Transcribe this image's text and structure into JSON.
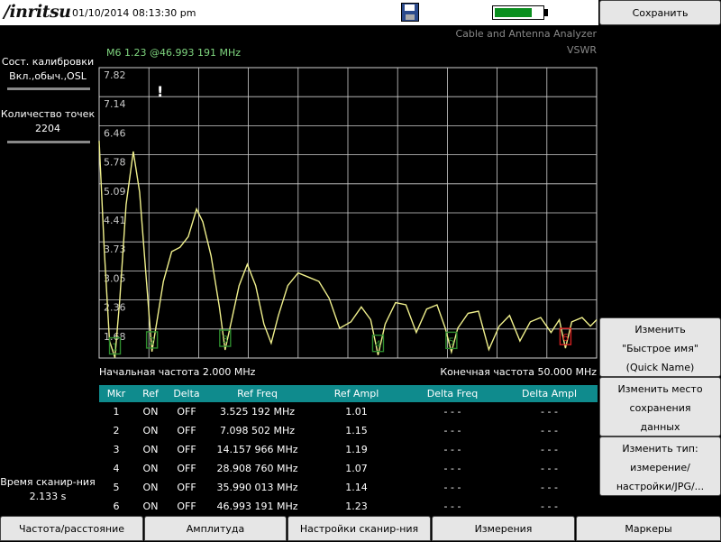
{
  "header": {
    "logo": "/inritsu",
    "datetime": "01/10/2014 08:13:30 pm",
    "save_icon": "floppy-disk-icon",
    "battery_level": 0.78,
    "battery_color": "#0a8f1e"
  },
  "instrument": {
    "title": "Cable and Antenna Analyzer",
    "mode": "VSWR"
  },
  "left_panel": {
    "calibration_label": "Сост. калибровки",
    "calibration_value": "Вкл.,обыч.,OSL",
    "points_label": "Количество точек",
    "points_value": "2204",
    "sweep_time_label": "Время сканир-ния",
    "sweep_time_value": "2.133 s"
  },
  "plot": {
    "marker_readout": "M6 1.23 @46.993 191 MHz",
    "start_freq": "Начальная частота 2.000 MHz",
    "stop_freq": "Конечная частота 50.000 MHz",
    "cursor_glyph": "!"
  },
  "chart_data": {
    "type": "line",
    "ylabel": "",
    "xlabel": "",
    "ylim": [
      1.0,
      7.82
    ],
    "xlim": [
      2.0,
      50.0
    ],
    "grid": true,
    "yticks": [
      "7.82",
      "7.14",
      "6.46",
      "5.78",
      "5.09",
      "4.41",
      "3.73",
      "3.05",
      "2.36",
      "1.68"
    ],
    "line_color": "#f0f08c",
    "grid_color": "#cfcfcf",
    "series": [
      {
        "x": [
          2.0,
          2.5,
          3.0,
          3.525,
          4.0,
          4.6,
          5.3,
          5.9,
          6.5,
          7.098,
          7.6,
          8.2,
          9.0,
          9.8,
          10.6,
          11.4,
          12.0,
          12.8,
          13.6,
          14.157,
          14.7,
          15.5,
          16.3,
          17.1,
          17.9,
          18.6,
          19.3,
          20.2,
          21.2,
          22.2,
          23.2,
          24.2,
          25.2,
          26.3,
          27.3,
          28.2,
          28.909,
          29.6,
          30.6,
          31.6,
          32.6,
          33.6,
          34.6,
          35.4,
          35.99,
          36.6,
          37.6,
          38.6,
          39.6,
          40.6,
          41.6,
          42.6,
          43.6,
          44.6,
          45.6,
          46.4,
          46.993,
          47.6,
          48.6,
          49.4,
          50.0
        ],
        "values": [
          6.1,
          3.5,
          1.4,
          1.01,
          2.4,
          4.6,
          5.85,
          4.9,
          3.0,
          1.15,
          1.9,
          2.8,
          3.5,
          3.6,
          3.85,
          4.5,
          4.2,
          3.4,
          2.2,
          1.19,
          1.8,
          2.7,
          3.2,
          2.7,
          1.8,
          1.35,
          2.0,
          2.7,
          3.0,
          2.9,
          2.8,
          2.4,
          1.7,
          1.85,
          2.2,
          1.9,
          1.07,
          1.8,
          2.3,
          2.25,
          1.6,
          2.15,
          2.25,
          1.7,
          1.14,
          1.7,
          2.05,
          2.1,
          1.2,
          1.75,
          2.0,
          1.4,
          1.85,
          1.95,
          1.6,
          1.9,
          1.23,
          1.85,
          1.95,
          1.75,
          1.9
        ]
      }
    ],
    "markers": [
      {
        "label": "1",
        "x": 3.525,
        "value": 1.01,
        "color": "#2e8b2e"
      },
      {
        "label": "2",
        "x": 7.098,
        "value": 1.15,
        "color": "#2e8b2e"
      },
      {
        "label": "3",
        "x": 14.157,
        "value": 1.19,
        "color": "#2e8b2e"
      },
      {
        "label": "4",
        "x": 28.909,
        "value": 1.07,
        "color": "#2e8b2e"
      },
      {
        "label": "5",
        "x": 35.99,
        "value": 1.14,
        "color": "#2e8b2e"
      },
      {
        "label": "6",
        "x": 46.993,
        "value": 1.23,
        "color": "#d42020"
      }
    ]
  },
  "marker_table": {
    "headers": [
      "Mkr",
      "Ref",
      "Delta",
      "Ref Freq",
      "Ref Ampl",
      "Delta Freq",
      "Delta Ampl"
    ],
    "rows": [
      [
        "1",
        "ON",
        "OFF",
        "3.525 192 MHz",
        "1.01",
        "- - -",
        "- - -"
      ],
      [
        "2",
        "ON",
        "OFF",
        "7.098 502 MHz",
        "1.15",
        "- - -",
        "- - -"
      ],
      [
        "3",
        "ON",
        "OFF",
        "14.157 966 MHz",
        "1.19",
        "- - -",
        "- - -"
      ],
      [
        "4",
        "ON",
        "OFF",
        "28.908 760 MHz",
        "1.07",
        "- - -",
        "- - -"
      ],
      [
        "5",
        "ON",
        "OFF",
        "35.990 013 MHz",
        "1.14",
        "- - -",
        "- - -"
      ],
      [
        "6",
        "ON",
        "OFF",
        "46.993 191 MHz",
        "1.23",
        "- - -",
        "- - -"
      ]
    ]
  },
  "right_menu": {
    "title_button": "Сохранить",
    "quick_name": [
      "Изменить",
      "\"Быстрое имя\"",
      "(Quick Name)"
    ],
    "change_location": [
      "Изменить место",
      "сохранения",
      "данных"
    ],
    "change_type": [
      "Изменить тип:",
      "измерение/",
      "настройки/JPG/..."
    ]
  },
  "bottom_menu": {
    "tabs": [
      "Частота/расстояние",
      "Амплитуда",
      "Настройки сканир-ния",
      "Измерения",
      "Маркеры"
    ]
  }
}
